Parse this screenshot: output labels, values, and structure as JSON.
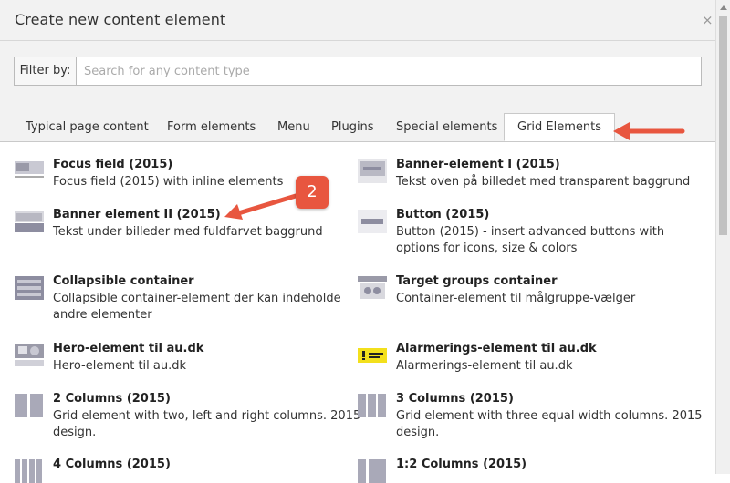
{
  "modal": {
    "title": "Create new content element",
    "close_label": "×"
  },
  "filter": {
    "label": "Filter by:",
    "placeholder": "Search for any content type",
    "value": ""
  },
  "tabs": [
    {
      "label": "Typical page content"
    },
    {
      "label": "Form elements"
    },
    {
      "label": "Menu"
    },
    {
      "label": "Plugins"
    },
    {
      "label": "Special elements"
    },
    {
      "label": "Grid Elements",
      "active": true
    }
  ],
  "annotation": {
    "badge": "2",
    "arrow_color": "#e8563f"
  },
  "items": [
    {
      "title": "Focus field (2015)",
      "desc": "Focus field (2015) with inline elements",
      "icon": "focus-field-thumb"
    },
    {
      "title": "Banner-element I (2015)",
      "desc": "Tekst oven på billedet med transparent baggrund",
      "icon": "banner-1-thumb"
    },
    {
      "title": "Banner element II (2015)",
      "desc": "Tekst under billeder med fuldfarvet baggrund",
      "icon": "banner-2-thumb"
    },
    {
      "title": "Button (2015)",
      "desc": "Button (2015) - insert advanced buttons with options for icons, size & colors",
      "icon": "button-thumb"
    },
    {
      "title": "Collapsible container",
      "desc": "Collapsible container-element der kan indeholde andre elementer",
      "icon": "collapsible-thumb"
    },
    {
      "title": "Target groups container",
      "desc": "Container-element til målgruppe-vælger",
      "icon": "target-groups-thumb"
    },
    {
      "title": "Hero-element til au.dk",
      "desc": "Hero-element til au.dk",
      "icon": "hero-thumb"
    },
    {
      "title": "Alarmerings-element til au.dk",
      "desc": "Alarmerings-element til au.dk",
      "icon": "alarm-thumb"
    },
    {
      "title": "2 Columns (2015)",
      "desc": "Grid element with two, left and right columns. 2015 design.",
      "icon": "two-columns-thumb"
    },
    {
      "title": "3 Columns (2015)",
      "desc": "Grid element with three equal width columns. 2015 design.",
      "icon": "three-columns-thumb"
    },
    {
      "title": "4 Columns (2015)",
      "desc": "",
      "icon": "four-columns-thumb"
    },
    {
      "title": "1:2 Columns (2015)",
      "desc": "",
      "icon": "one-two-columns-thumb"
    }
  ]
}
